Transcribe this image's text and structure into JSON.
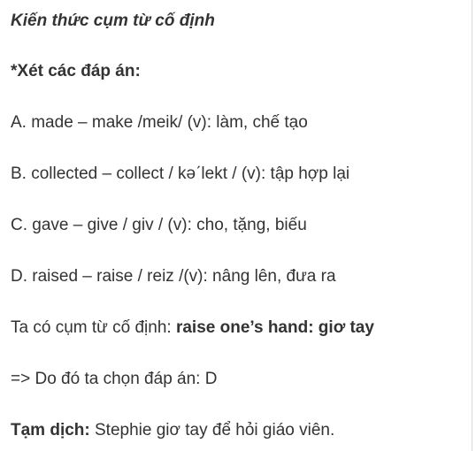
{
  "heading": "Kiến thức cụm từ cố định",
  "options_title": "*Xét các đáp án:",
  "options": [
    "A. made – make /meik/ (v): làm, chế tạo",
    "B. collected – collect / kəˊlekt / (v): tập hợp lại",
    "C. gave – give / giv / (v): cho, tặng, biếu",
    "D. raised – raise / reiz /(v): nâng lên, đưa ra"
  ],
  "phrase": {
    "prefix": "Ta có cụm từ cố định: ",
    "bold": "raise one’s hand: giơ tay"
  },
  "conclusion": "=> Do đó ta chọn đáp án: D",
  "translation": {
    "label": "Tạm dịch:",
    "text": " Stephie giơ tay để hỏi giáo viên."
  }
}
